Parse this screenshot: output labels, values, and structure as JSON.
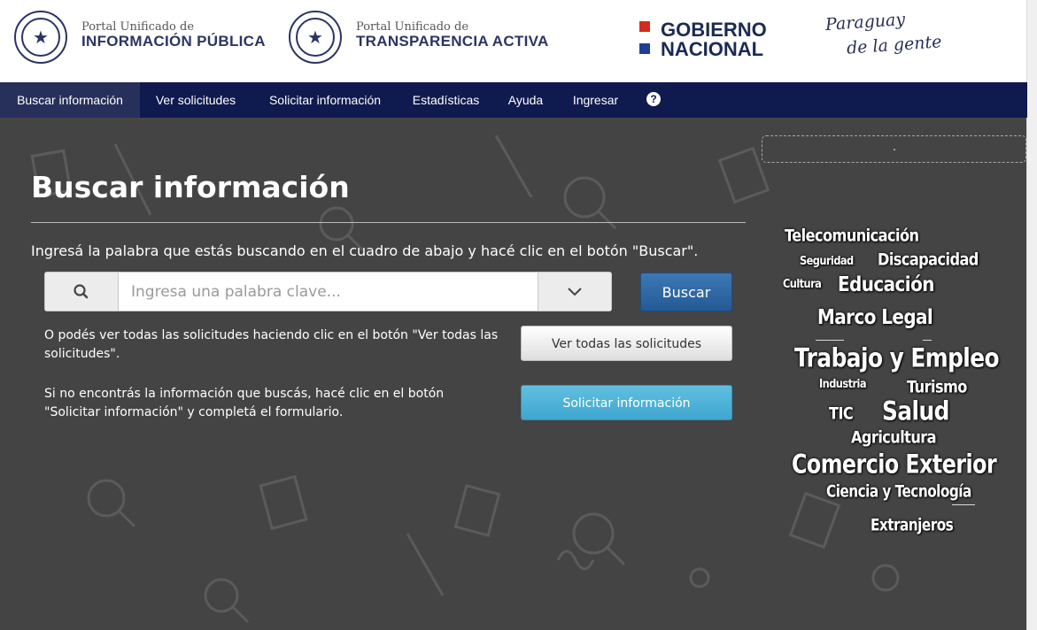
{
  "header": {
    "portal1": {
      "small": "Portal Unificado de",
      "big": "INFORMACIÓN PÚBLICA"
    },
    "portal2": {
      "small": "Portal Unificado de",
      "big": "TRANSPARENCIA ACTIVA"
    },
    "gobierno": {
      "line1": "GOBIERNO",
      "line2": "NACIONAL"
    },
    "paraguay": {
      "line1": "Paraguay",
      "line2": "de la gente"
    }
  },
  "nav": {
    "items": [
      {
        "label": "Buscar información"
      },
      {
        "label": "Ver solicitudes"
      },
      {
        "label": "Solicitar información"
      },
      {
        "label": "Estadísticas"
      },
      {
        "label": "Ayuda"
      },
      {
        "label": "Ingresar"
      }
    ],
    "help_glyph": "?"
  },
  "main": {
    "title": "Buscar información",
    "instruction": "Ingresá la palabra que estás buscando en el cuadro de abajo y hacé clic en el botón \"Buscar\".",
    "search": {
      "placeholder": "Ingresa una palabra clave...",
      "value": ""
    },
    "search_button": "Buscar",
    "ver_text": "O podés ver todas las solicitudes haciendo clic en el botón \"Ver todas las solicitudes\".",
    "ver_button": "Ver todas las solicitudes",
    "solicitar_text": "Si no encontrás la información que buscás, hacé clic en el botón \"Solicitar información\" y completá el formulario.",
    "solicitar_button": "Solicitar información"
  },
  "sidebar": {
    "box_text": ".",
    "tags": [
      {
        "text": "Telecomunicación"
      },
      {
        "text": "Seguridad"
      },
      {
        "text": "Discapacidad"
      },
      {
        "text": "Cultura"
      },
      {
        "text": "Educación"
      },
      {
        "text": "Marco Legal"
      },
      {
        "text": "Trabajo y Empleo"
      },
      {
        "text": "Industria"
      },
      {
        "text": "Turismo"
      },
      {
        "text": "TIC"
      },
      {
        "text": "Salud"
      },
      {
        "text": "Agricultura"
      },
      {
        "text": "Comercio Exterior"
      },
      {
        "text": "Ciencia y Tecnología"
      },
      {
        "text": "Extranjeros"
      }
    ]
  },
  "colors": {
    "nav_bg": "#0f1a4e",
    "page_bg": "#444444",
    "primary_button": "#2f6aa6",
    "info_button": "#4fb3da",
    "flag_red": "#d52b1e",
    "flag_blue": "#1c3f94"
  },
  "icons": {
    "seal": "paraguay-seal-icon",
    "search": "search-icon",
    "dropdown": "chevron-down-icon",
    "help": "help-circle-icon"
  }
}
